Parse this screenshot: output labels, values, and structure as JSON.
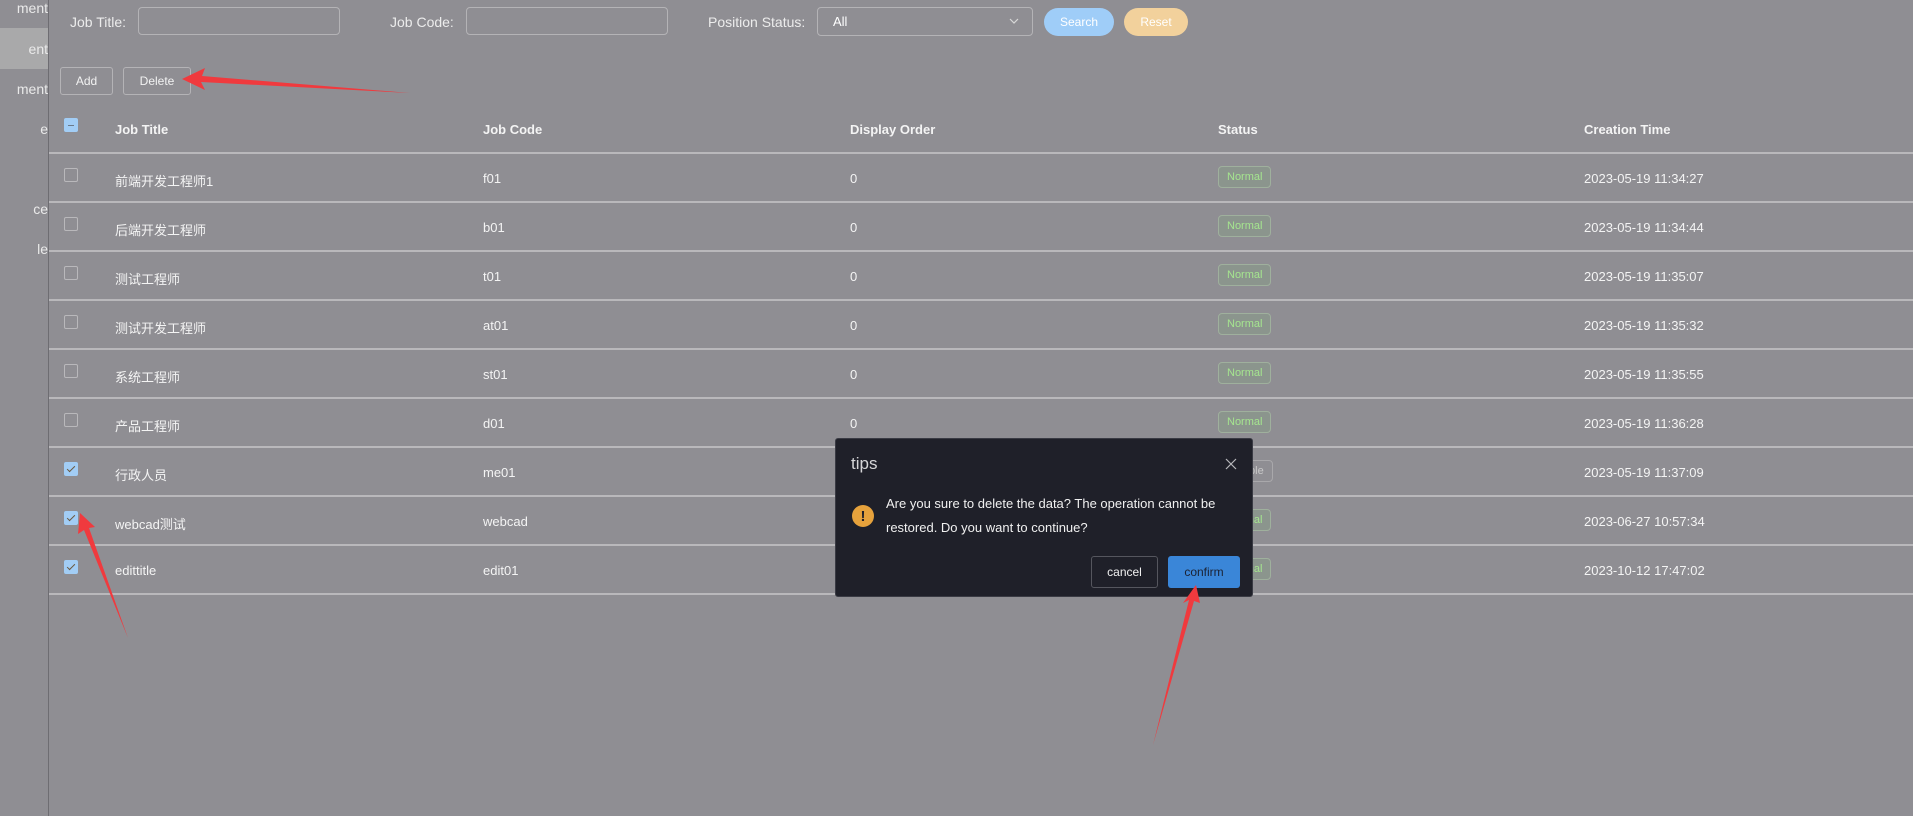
{
  "sidebar": {
    "items": [
      {
        "label": "ment",
        "active": false
      },
      {
        "label": "ent",
        "active": true
      },
      {
        "label": "ment",
        "active": false
      },
      {
        "label": "e",
        "active": false
      },
      {
        "label": "",
        "active": false
      },
      {
        "label": "ce",
        "active": false
      },
      {
        "label": "le",
        "active": false
      }
    ]
  },
  "filters": {
    "job_title_label": "Job Title:",
    "job_title_value": "",
    "job_code_label": "Job Code:",
    "job_code_value": "",
    "position_status_label": "Position Status:",
    "position_status_value": "All",
    "search_label": "Search",
    "reset_label": "Reset"
  },
  "toolbar": {
    "add_label": "Add",
    "delete_label": "Delete"
  },
  "table": {
    "columns": [
      "Job Title",
      "Job Code",
      "Display Order",
      "Status",
      "Creation Time"
    ],
    "rows": [
      {
        "title": "前端开发工程师1",
        "code": "f01",
        "order": "0",
        "status": "Normal",
        "created": "2023-05-19 11:34:27",
        "checked": false
      },
      {
        "title": "后端开发工程师",
        "code": "b01",
        "order": "0",
        "status": "Normal",
        "created": "2023-05-19 11:34:44",
        "checked": false
      },
      {
        "title": "测试工程师",
        "code": "t01",
        "order": "0",
        "status": "Normal",
        "created": "2023-05-19 11:35:07",
        "checked": false
      },
      {
        "title": "测试开发工程师",
        "code": "at01",
        "order": "0",
        "status": "Normal",
        "created": "2023-05-19 11:35:32",
        "checked": false
      },
      {
        "title": "系统工程师",
        "code": "st01",
        "order": "0",
        "status": "Normal",
        "created": "2023-05-19 11:35:55",
        "checked": false
      },
      {
        "title": "产品工程师",
        "code": "d01",
        "order": "0",
        "status": "Normal",
        "created": "2023-05-19 11:36:28",
        "checked": false
      },
      {
        "title": "行政人员",
        "code": "me01",
        "order": "",
        "status": "Disable",
        "created": "2023-05-19 11:37:09",
        "checked": true
      },
      {
        "title": "webcad测试",
        "code": "webcad",
        "order": "",
        "status": "Normal",
        "created": "2023-06-27 10:57:34",
        "checked": true
      },
      {
        "title": "edittitle",
        "code": "edit01",
        "order": "",
        "status": "Normal",
        "created": "2023-10-12 17:47:02",
        "checked": true
      }
    ]
  },
  "dialog": {
    "title": "tips",
    "icon": "warning-icon",
    "message": "Are you sure to delete the data? The operation cannot be restored. Do you want to continue?",
    "cancel_label": "cancel",
    "confirm_label": "confirm"
  },
  "colors": {
    "search_button": "#9fcdf8",
    "reset_button": "#f2d19c",
    "confirm_button": "#3a86d8",
    "normal_status": "#a5e58f",
    "warning_icon": "#e6a23c",
    "annotation_arrow": "#f03a3e"
  }
}
